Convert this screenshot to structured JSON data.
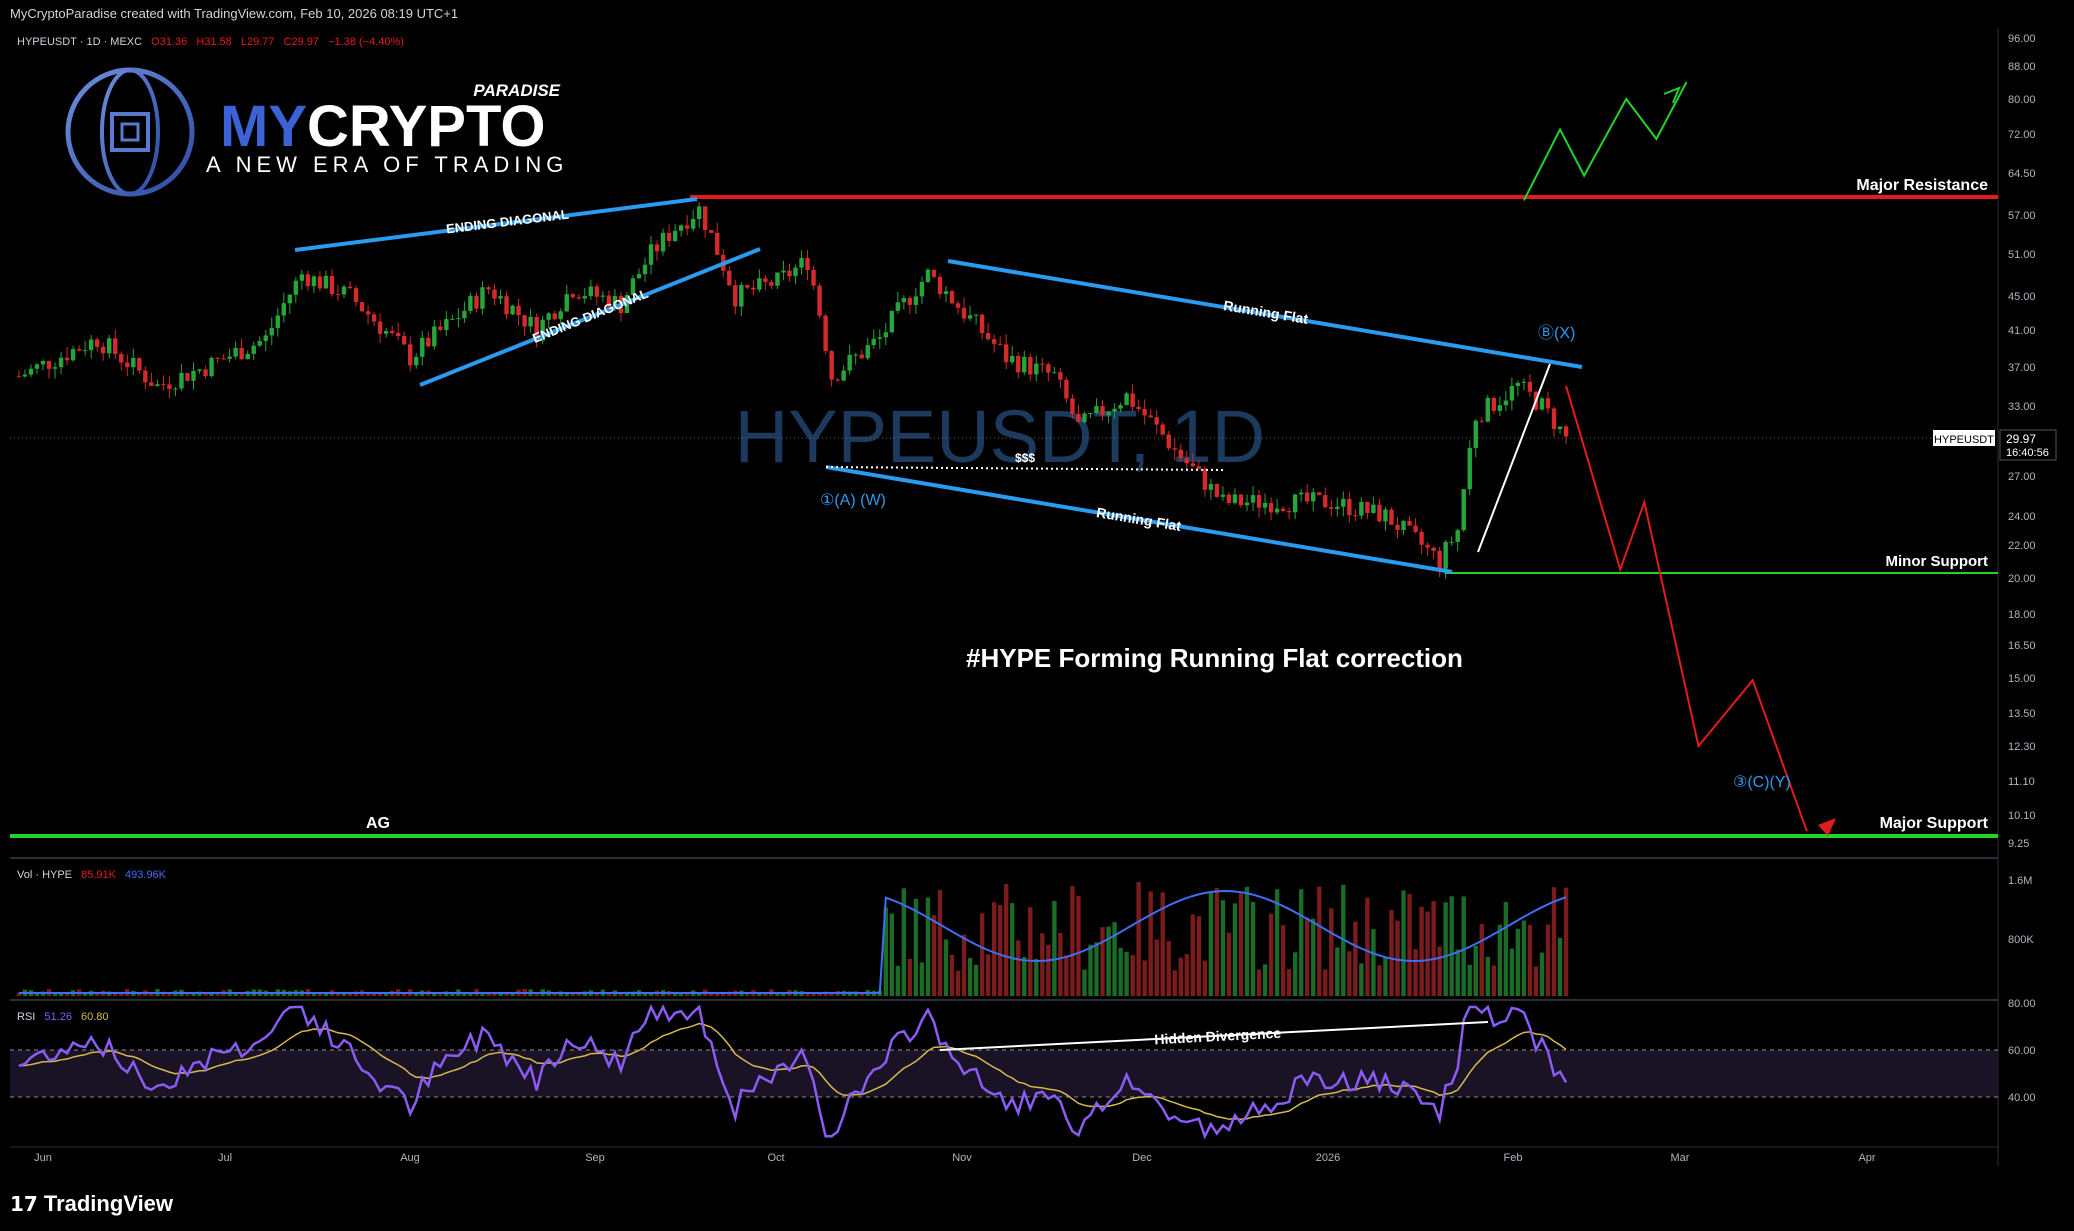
{
  "header": {
    "credit": "MyCryptoParadise created with TradingView.com, Feb 10, 2026 08:19 UTC+1"
  },
  "symbol_line": {
    "name": "HYPEUSDT · 1D · MEXC",
    "open": "O31.36",
    "high": "H31.58",
    "low": "L29.77",
    "close": "C29.97",
    "change": "−1.38 (−4.40%)"
  },
  "logo": {
    "paradise": "PARADISE",
    "my": "MY",
    "crypto": "CRYPTO",
    "tagline": "A NEW ERA OF TRADING"
  },
  "watermark": "HYPEUSDT, 1D",
  "colors": {
    "resistance": "#e31b1b",
    "support": "#22d32b",
    "channel": "#2a9bf0",
    "wave_label": "#2a9bf0",
    "candle_up": "#26a63a",
    "candle_down": "#d42a2a",
    "projection_up": "#22d32b",
    "projection_down": "#e31b1b",
    "rsi": "#8a5cf5",
    "rsi_ma": "#d6b94b",
    "vol_ma": "#3d6ef5"
  },
  "annotations": {
    "major_resistance": "Major Resistance",
    "minor_support": "Minor Support",
    "major_support": "Major Support",
    "ag": "AG",
    "ending_diagonal_top": "ENDING DIAGONAL",
    "ending_diagonal_bottom": "ENDING DIAGONAL",
    "running_flat_top": "Running Flat",
    "running_flat_bottom": "Running Flat",
    "liquidity": "$$$",
    "wave_a": "①(A) (W)",
    "wave_b": "Ⓑ(X)",
    "wave_c": "③(C)(Y)",
    "headline": "#HYPE Forming Running Flat correction",
    "hidden_divergence": "Hidden Divergence"
  },
  "price_badge": {
    "symbol": "HYPEUSDT",
    "price": "29.97",
    "countdown": "16:40:56"
  },
  "volume_legend": {
    "label": "Vol · HYPE",
    "value1": "85.91K",
    "value2": "493.96K"
  },
  "rsi_legend": {
    "label": "RSI",
    "value1": "51.26",
    "value2": "60.80"
  },
  "footer": {
    "brand": "TradingView"
  },
  "chart_data": {
    "type": "line",
    "title": "HYPEUSDT · 1D · MEXC",
    "price_axis_ticks": [
      "96.00",
      "88.00",
      "80.00",
      "72.00",
      "64.50",
      "57.00",
      "51.00",
      "45.00",
      "41.00",
      "37.00",
      "33.00",
      "29.97",
      "27.00",
      "24.00",
      "22.00",
      "20.00",
      "18.00",
      "16.50",
      "15.00",
      "13.50",
      "12.30",
      "11.10",
      "10.10",
      "9.25"
    ],
    "time_axis_ticks": [
      "Jun",
      "Jul",
      "Aug",
      "Sep",
      "Oct",
      "Nov",
      "Dec",
      "2026",
      "Feb",
      "Mar",
      "Apr"
    ],
    "volume_axis_ticks": [
      "1.6M",
      "800K"
    ],
    "rsi_axis_ticks": [
      "80.00",
      "60.00",
      "40.00"
    ],
    "levels": {
      "major_resistance": 59.5,
      "minor_support": 20.3,
      "major_support": 9.6,
      "last_price": 29.97
    },
    "price_series": [
      {
        "date": "2025-05-28",
        "close": 36
      },
      {
        "date": "2025-06-10",
        "close": 40
      },
      {
        "date": "2025-06-20",
        "close": 35
      },
      {
        "date": "2025-06-28",
        "close": 37
      },
      {
        "date": "2025-07-08",
        "close": 40
      },
      {
        "date": "2025-07-14",
        "close": 48
      },
      {
        "date": "2025-07-22",
        "close": 45
      },
      {
        "date": "2025-08-01",
        "close": 38
      },
      {
        "date": "2025-08-08",
        "close": 42
      },
      {
        "date": "2025-08-14",
        "close": 46
      },
      {
        "date": "2025-08-22",
        "close": 41
      },
      {
        "date": "2025-08-28",
        "close": 46
      },
      {
        "date": "2025-09-05",
        "close": 44
      },
      {
        "date": "2025-09-10",
        "close": 51
      },
      {
        "date": "2025-09-14",
        "close": 55
      },
      {
        "date": "2025-09-18",
        "close": 58
      },
      {
        "date": "2025-09-24",
        "close": 45
      },
      {
        "date": "2025-10-01",
        "close": 47
      },
      {
        "date": "2025-10-06",
        "close": 50
      },
      {
        "date": "2025-10-10",
        "close": 36
      },
      {
        "date": "2025-10-18",
        "close": 40
      },
      {
        "date": "2025-10-26",
        "close": 48
      },
      {
        "date": "2025-11-01",
        "close": 43
      },
      {
        "date": "2025-11-08",
        "close": 38
      },
      {
        "date": "2025-11-16",
        "close": 36
      },
      {
        "date": "2025-11-20",
        "close": 31
      },
      {
        "date": "2025-11-28",
        "close": 34
      },
      {
        "date": "2025-12-06",
        "close": 29
      },
      {
        "date": "2025-12-14",
        "close": 25
      },
      {
        "date": "2025-12-22",
        "close": 25
      },
      {
        "date": "2026-01-01",
        "close": 25
      },
      {
        "date": "2026-01-10",
        "close": 24
      },
      {
        "date": "2026-01-19",
        "close": 21
      },
      {
        "date": "2026-01-22",
        "close": 23
      },
      {
        "date": "2026-01-25",
        "close": 32
      },
      {
        "date": "2026-02-01",
        "close": 35
      },
      {
        "date": "2026-02-05",
        "close": 33
      },
      {
        "date": "2026-02-09",
        "close": 29.97
      }
    ],
    "projection_down": [
      {
        "date": "2026-02-09",
        "value": 35
      },
      {
        "date": "2026-02-18",
        "value": 20.5
      },
      {
        "date": "2026-02-22",
        "value": 25
      },
      {
        "date": "2026-03-03",
        "value": 12.3
      },
      {
        "date": "2026-03-12",
        "value": 14.9
      },
      {
        "date": "2026-03-21",
        "value": 9.6
      }
    ],
    "projection_up": [
      {
        "date": "2026-02-02",
        "value": 59.5
      },
      {
        "date": "2026-02-08",
        "value": 73
      },
      {
        "date": "2026-02-12",
        "value": 64
      },
      {
        "date": "2026-02-19",
        "value": 80
      },
      {
        "date": "2026-02-24",
        "value": 71
      },
      {
        "date": "2026-03-01",
        "value": 84
      }
    ]
  }
}
